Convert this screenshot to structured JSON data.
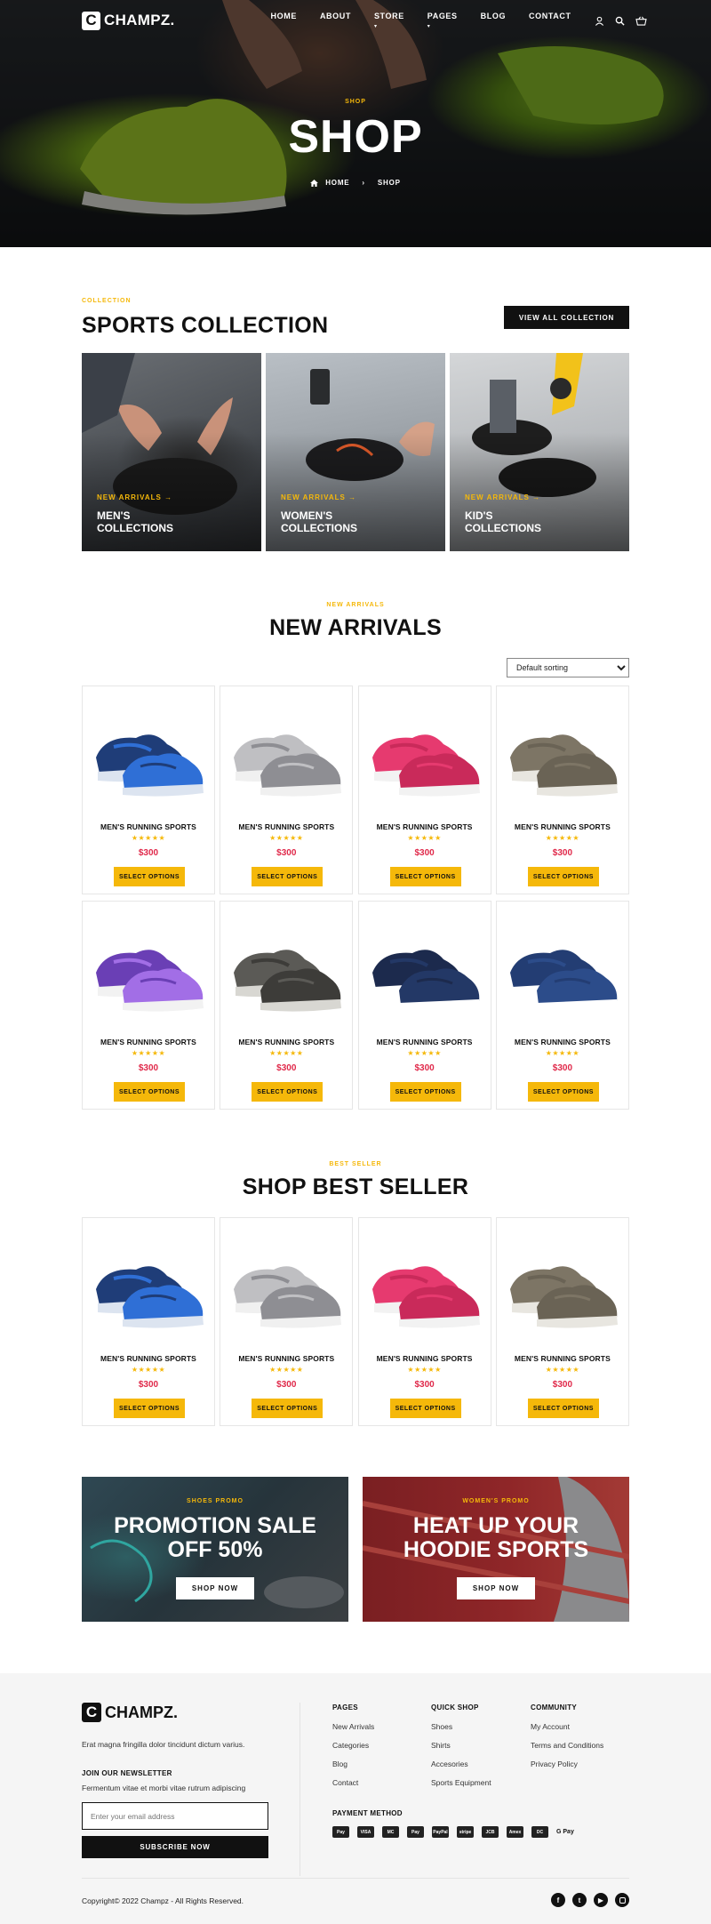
{
  "header": {
    "logo_letter": "C",
    "logo_text": "CHAMPZ.",
    "nav": [
      "HOME",
      "ABOUT",
      "STORE",
      "PAGES",
      "BLOG",
      "CONTACT"
    ]
  },
  "hero": {
    "kicker": "SHOP",
    "title": "SHOP",
    "breadcrumb_home": "HOME",
    "breadcrumb_current": "SHOP"
  },
  "collection": {
    "kicker": "COLLECTION",
    "title": "SPORTS COLLECTION",
    "button": "VIEW ALL COLLECTION",
    "cards": [
      {
        "tag": "NEW ARRIVALS",
        "name": "MEN'S COLLECTIONS"
      },
      {
        "tag": "NEW ARRIVALS",
        "name": "WOMEN'S COLLECTIONS"
      },
      {
        "tag": "NEW ARRIVALS",
        "name": "KID'S COLLECTIONS"
      }
    ]
  },
  "arrivals": {
    "kicker": "NEW ARRIVALS",
    "title": "NEW ARRIVALS",
    "sort_selected": "Default sorting",
    "products": [
      {
        "name": "MEN'S RUNNING SPORTS",
        "price": "$300",
        "button": "SELECT OPTIONS",
        "rating": 5
      },
      {
        "name": "MEN'S RUNNING SPORTS",
        "price": "$300",
        "button": "SELECT OPTIONS",
        "rating": 5
      },
      {
        "name": "MEN'S RUNNING SPORTS",
        "price": "$300",
        "button": "SELECT OPTIONS",
        "rating": 5
      },
      {
        "name": "MEN'S RUNNING SPORTS",
        "price": "$300",
        "button": "SELECT OPTIONS",
        "rating": 5
      },
      {
        "name": "MEN'S RUNNING SPORTS",
        "price": "$300",
        "button": "SELECT OPTIONS",
        "rating": 5
      },
      {
        "name": "MEN'S RUNNING SPORTS",
        "price": "$300",
        "button": "SELECT OPTIONS",
        "rating": 5
      },
      {
        "name": "MEN'S RUNNING SPORTS",
        "price": "$300",
        "button": "SELECT OPTIONS",
        "rating": 5
      },
      {
        "name": "MEN'S RUNNING SPORTS",
        "price": "$300",
        "button": "SELECT OPTIONS",
        "rating": 5
      }
    ]
  },
  "bestseller": {
    "kicker": "BEST SELLER",
    "title": "SHOP BEST SELLER",
    "products": [
      {
        "name": "MEN'S RUNNING SPORTS",
        "price": "$300",
        "button": "SELECT OPTIONS",
        "rating": 5
      },
      {
        "name": "MEN'S RUNNING SPORTS",
        "price": "$300",
        "button": "SELECT OPTIONS",
        "rating": 5
      },
      {
        "name": "MEN'S RUNNING SPORTS",
        "price": "$300",
        "button": "SELECT OPTIONS",
        "rating": 5
      },
      {
        "name": "MEN'S RUNNING SPORTS",
        "price": "$300",
        "button": "SELECT OPTIONS",
        "rating": 5
      }
    ]
  },
  "promos": [
    {
      "kicker": "SHOES PROMO",
      "title_line1": "PROMOTION SALE",
      "title_line2": "OFF 50%",
      "button": "SHOP NOW"
    },
    {
      "kicker": "WOMEN'S PROMO",
      "title_line1": "HEAT UP YOUR",
      "title_line2": "HOODIE SPORTS",
      "button": "SHOP NOW"
    }
  ],
  "footer": {
    "logo_letter": "C",
    "logo_text": "CHAMPZ.",
    "about": "Erat magna fringilla dolor tincidunt dictum varius.",
    "newsletter_title": "JOIN OUR NEWSLETTER",
    "newsletter_text": "Fermentum vitae et morbi vitae rutrum adipiscing",
    "email_placeholder": "Enter your email address",
    "subscribe": "SUBSCRIBE NOW",
    "pages_title": "PAGES",
    "pages": [
      "New Arrivals",
      "Categories",
      "Blog",
      "Contact"
    ],
    "quick_title": "QUICK SHOP",
    "quick": [
      "Shoes",
      "Shirts",
      "Accesories",
      "Sports Equipment"
    ],
    "community_title": "COMMUNITY",
    "community": [
      "My Account",
      "Terms and Conditions",
      "Privacy Policy"
    ],
    "payment_title": "PAYMENT METHOD",
    "payments": [
      "Pay",
      "VISA",
      "MC",
      "Pay",
      "PayPal",
      "stripe",
      "JCB",
      "Amex",
      "DC",
      "G Pay"
    ],
    "copyright": "Copyright© 2022 Champz - All Rights Reserved."
  },
  "colors": {
    "accent": "#f5b80a",
    "price": "#e0294a",
    "dark": "#111111"
  }
}
